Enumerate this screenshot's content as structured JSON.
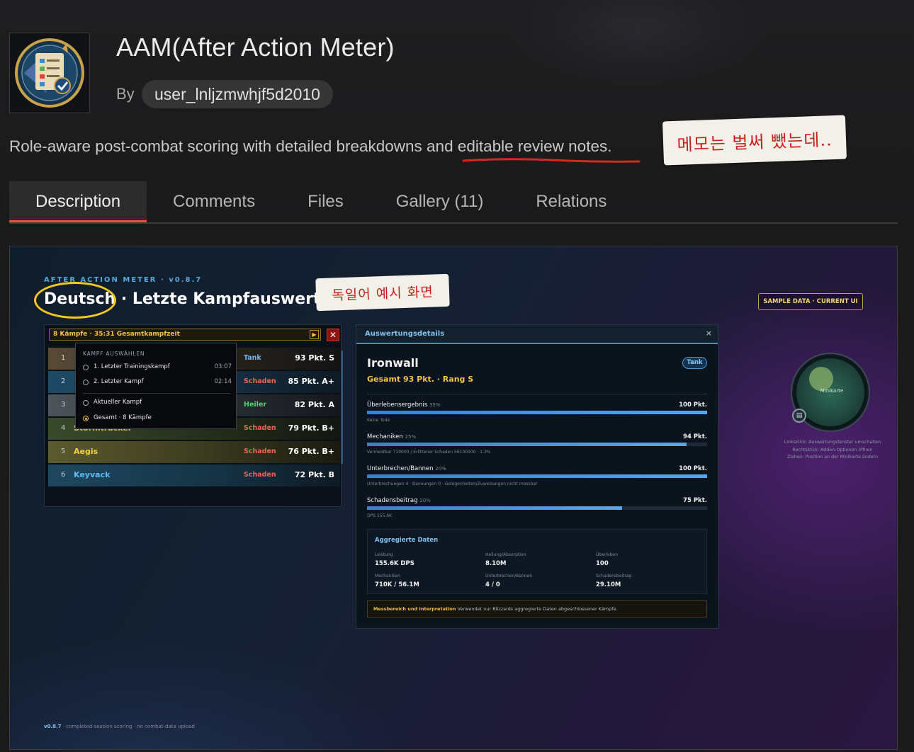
{
  "addon": {
    "title": "AAM(After Action Meter)",
    "by_label": "By",
    "author": "user_lnljzmwhjf5d2010",
    "summary": "Role-aware post-combat scoring with detailed breakdowns and editable review notes.",
    "note": "메모는 벌써 뺐는데.."
  },
  "tabs": [
    {
      "label": "Description",
      "active": true
    },
    {
      "label": "Comments"
    },
    {
      "label": "Files"
    },
    {
      "label": "Gallery (11)"
    },
    {
      "label": "Relations"
    }
  ],
  "screenshot": {
    "brand": "AFTER ACTION METER · v0.8.7",
    "title": "Deutsch · Letzte Kampfauswertung",
    "annotation": "독일어 예시 화면",
    "sample_badge": "SAMPLE DATA · CURRENT UI",
    "meter": {
      "header": "8 Kämpfe · 35:31 Gesamtkampfzeit",
      "play_icon": "▶",
      "close_icon": "✕",
      "rows": [
        {
          "rank": "1",
          "name": "",
          "role": "Tank",
          "score": "93 Pkt. S"
        },
        {
          "rank": "2",
          "name": "",
          "role": "Schaden",
          "score": "85 Pkt. A+"
        },
        {
          "rank": "3",
          "name": "",
          "role": "Heiler",
          "score": "82 Pkt. A"
        },
        {
          "rank": "4",
          "name": "Stormtracker",
          "role": "Schaden",
          "score": "79 Pkt. B+"
        },
        {
          "rank": "5",
          "name": "Aegis",
          "role": "Schaden",
          "score": "76 Pkt. B+"
        },
        {
          "rank": "6",
          "name": "Keyvack",
          "role": "Schaden",
          "score": "72 Pkt. B"
        }
      ],
      "dropdown": {
        "heading": "KAMPF AUSWÄHLEN",
        "items": [
          {
            "label": "1. Letzter Trainingskampf",
            "time": "03:07",
            "selected": false
          },
          {
            "label": "2. Letzter Kampf",
            "time": "02:14",
            "selected": false
          },
          {
            "label": "Aktueller Kampf",
            "time": "",
            "selected": false
          },
          {
            "label": "Gesamt · 8 Kämpfe",
            "time": "",
            "selected": true
          }
        ]
      }
    },
    "details": {
      "header": "Auswertungsdetails",
      "close_icon": "×",
      "player": "Ironwall",
      "total": "Gesamt 93 Pkt. · Rang S",
      "role": "Tank",
      "metrics": [
        {
          "label": "Überlebensergebnis",
          "weight": "35%",
          "value": "100 Pkt.",
          "fill": 1.0,
          "sub": "Keine Tode"
        },
        {
          "label": "Mechaniken",
          "weight": "25%",
          "value": "94 Pkt.",
          "fill": 0.94,
          "sub": "Vermeidbar 710000 / Erlittener Schaden 56100000 · 1.3%"
        },
        {
          "label": "Unterbrechen/Bannen",
          "weight": "20%",
          "value": "100 Pkt.",
          "fill": 1.0,
          "sub": "Unterbrechungen 4 · Bannungen 0 · Gelegenheiten/Zuweisungen nicht messbar"
        },
        {
          "label": "Schadensbeitrag",
          "weight": "20%",
          "value": "75 Pkt.",
          "fill": 0.75,
          "sub": "DPS 155.6K"
        }
      ],
      "aggregate": {
        "title": "Aggregierte Daten",
        "cells": [
          {
            "key": "Leistung",
            "value": "155.6K DPS"
          },
          {
            "key": "Heilung/Absorption",
            "value": "8.10M"
          },
          {
            "key": "Überleben",
            "value": "100"
          },
          {
            "key": "Mechaniken",
            "value": "710K / 56.1M"
          },
          {
            "key": "Unterbrechen/Bannen",
            "value": "4 / 0"
          },
          {
            "key": "Schadensbeitrag",
            "value": "29.10M"
          }
        ]
      },
      "scope": {
        "label": "Messbereich und Interpretation",
        "text": "Verwendet nur Blizzards aggregierte Daten abgeschlossener Kämpfe."
      }
    },
    "minimap": {
      "label": "Minikarte",
      "help": [
        "Linksklick: Auswertungsfenster umschalten",
        "Rechtsklick: Addon-Optionen öffnen",
        "Ziehen: Position an der Minikarte ändern"
      ]
    },
    "footer": {
      "version": "v0.8.7",
      "text": " · completed-session scoring · no combat-data upload"
    }
  },
  "colors": {
    "accent_tab": "#e2552d",
    "gold": "#f0c14b",
    "tank": "#6fb6ee",
    "damage": "#e26b55",
    "healer": "#55d36b"
  }
}
